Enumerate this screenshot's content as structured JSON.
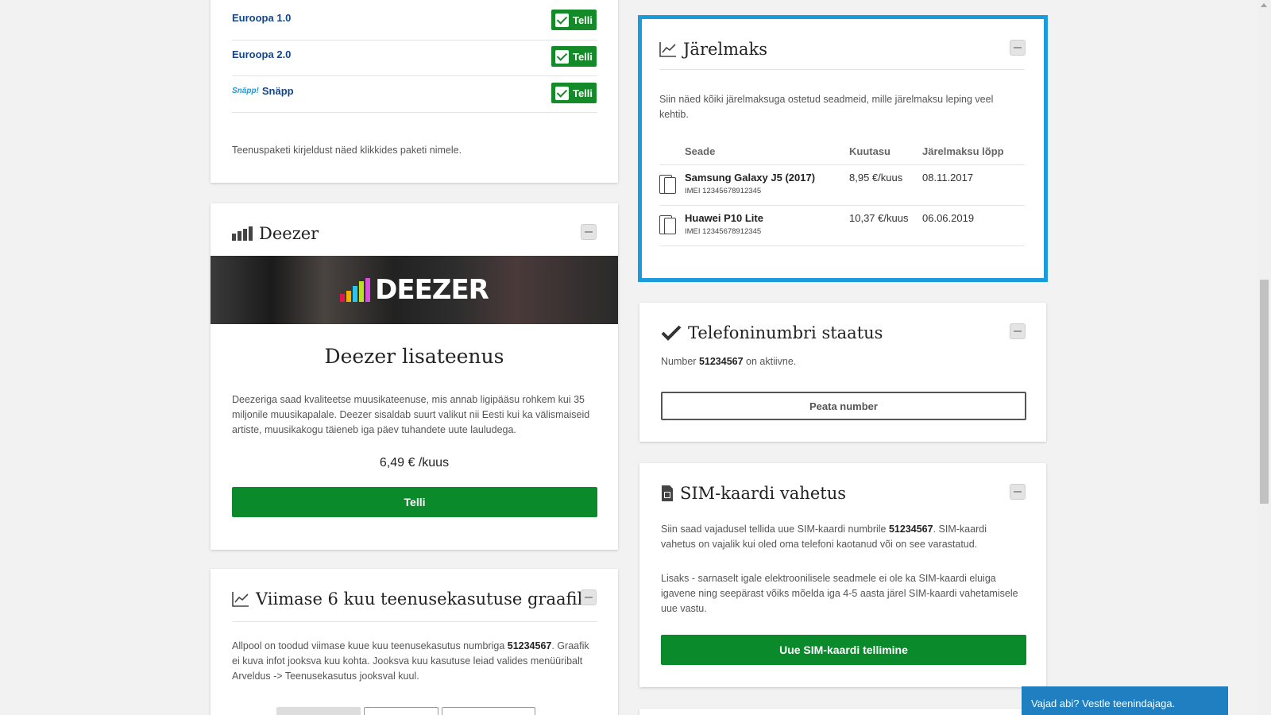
{
  "packages": [
    {
      "name": "Euroopa 1.0",
      "action": "Telli"
    },
    {
      "name": "Euroopa 2.0",
      "action": "Telli"
    },
    {
      "name": "Snäpp",
      "logo": "Snäpp!",
      "action": "Telli"
    }
  ],
  "packages_note": "Teenuspaketi kirjeldust näed klikkides paketi nimele.",
  "deezer": {
    "title": "Deezer",
    "banner_logo": "DEEZER",
    "heading": "Deezer lisateenus",
    "description": "Deezeriga saad kvaliteetse muusikateenuse, mis annab ligipääsu rohkem kui 35 miljonile muusikapalale. Deezer sisaldab suurt valikut nii Eesti kui ka välismaiseid artiste, muusikakogu täieneb iga päev tuhandete uute lauludega.",
    "price": "6,49 € /kuus",
    "button": "Telli"
  },
  "usage": {
    "title": "Viimase 6 kuu teenusekasutuse graafik",
    "text_1": "Allpool on toodud viimase kuue kuu teenusekasutus numbriga ",
    "number": "51234567",
    "text_2": ". Graafik ei kuva infot jooksva kuu kohta. Jooksva kuu kasutuse leiad valides menüüribalt Arveldus -> Teenusekasutus jooksval kuul."
  },
  "jarelmaks": {
    "title": "Järelmaks",
    "description": "Siin näed kõiki järelmaksuga ostetud seadmeid, mille järelmaksu leping veel kehtib.",
    "columns": [
      "Seade",
      "Kuutasu",
      "Järelmaksu lõpp"
    ],
    "rows": [
      {
        "device": "Samsung Galaxy J5 (2017)",
        "imei": "IMEI 12345678912345",
        "fee": "8,95 €/kuus",
        "end": "08.11.2017"
      },
      {
        "device": "Huawei P10 Lite",
        "imei": "IMEI 12345678912345",
        "fee": "10,37 €/kuus",
        "end": "06.06.2019"
      }
    ],
    "highlight_color": "#1a9bdb"
  },
  "status": {
    "title": "Telefoninumbri staatus",
    "prefix": "Number ",
    "number": "51234567",
    "suffix": " on aktiivne.",
    "button": "Peata number"
  },
  "sim": {
    "title": "SIM-kaardi vahetus",
    "p1_a": "Siin saad vajadusel tellida uue SIM-kaardi numbrile ",
    "p1_number": "51234567",
    "p1_b": ". SIM-kaardi vahetus on vajalik kui oled oma telefoni kaotanud või on see varastatud.",
    "p2": "Lisaks - sarnaselt igale elektroonilisele seadmele ei ole ka SIM-kaardi eluiga igavene ning seepärast võiks mõelda iga 4-5 aasta järel SIM-kaardi vahetamisele uue vastu.",
    "button": "Uue SIM-kaardi tellimine"
  },
  "chat": {
    "label": "Vajad abi? Vestle teenindajaga."
  },
  "colors": {
    "green": "#0b8a2b",
    "link_blue": "#14468b",
    "accent_blue": "#1a9bdb"
  }
}
